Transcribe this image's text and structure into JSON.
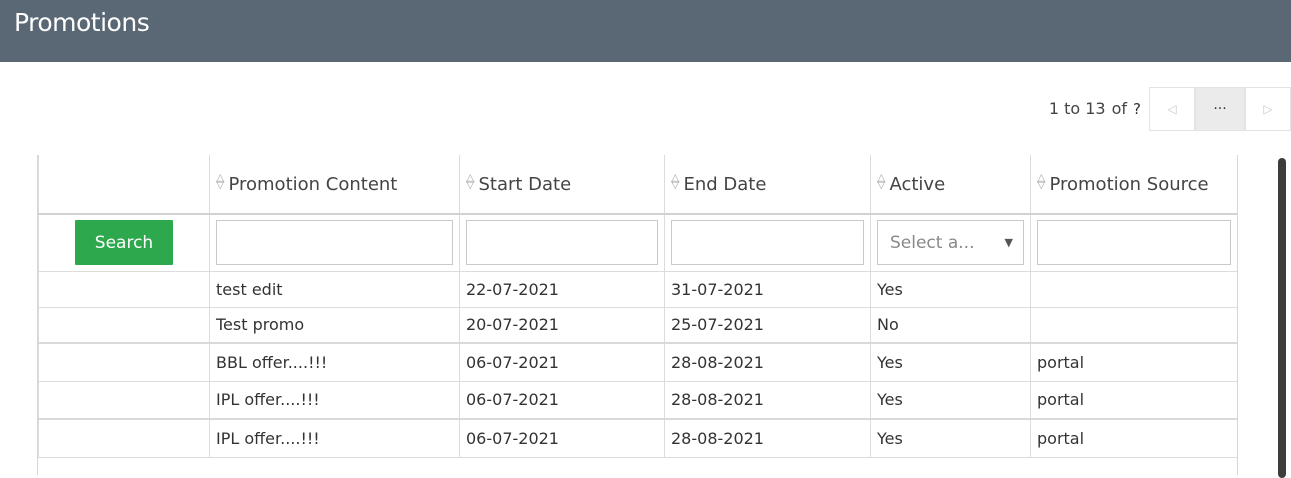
{
  "header": {
    "title": "Promotions"
  },
  "pager": {
    "range": "1 to 13",
    "of": "of",
    "total": "?",
    "prev_icon": "◁",
    "more": "···",
    "next_icon": "▷"
  },
  "grid": {
    "columns": [
      "",
      "Promotion Content",
      "Start Date",
      "End Date",
      "Active",
      "Promotion Source"
    ],
    "search_label": "Search",
    "active_placeholder": "Select a...",
    "rows": [
      [
        "",
        "test edit",
        "22-07-2021",
        "31-07-2021",
        "Yes",
        ""
      ],
      [
        "",
        "Test promo",
        "20-07-2021",
        "25-07-2021",
        "No",
        ""
      ],
      [
        "",
        "BBL offer....!!!",
        "06-07-2021",
        "28-08-2021",
        "Yes",
        "portal"
      ],
      [
        "",
        "IPL offer....!!!",
        "06-07-2021",
        "28-08-2021",
        "Yes",
        "portal"
      ],
      [
        "",
        "IPL offer....!!!",
        "06-07-2021",
        "28-08-2021",
        "Yes",
        "portal"
      ]
    ]
  },
  "colors": {
    "header_bg": "#5a6774",
    "search_button": "#2ea84d"
  }
}
